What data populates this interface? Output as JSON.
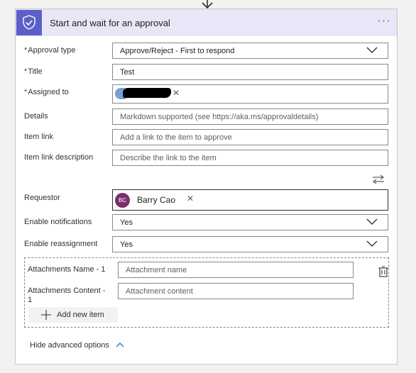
{
  "header": {
    "title": "Start and wait for an approval",
    "more_label": "···"
  },
  "fields": {
    "approval_type": {
      "label": "Approval type",
      "required": "*",
      "value": "Approve/Reject - First to respond"
    },
    "title": {
      "label": "Title",
      "required": "*",
      "value": "Test"
    },
    "assigned_to": {
      "label": "Assigned to",
      "required": "*"
    },
    "details": {
      "label": "Details",
      "placeholder": "Markdown supported (see https://aka.ms/approvaldetails)"
    },
    "item_link": {
      "label": "Item link",
      "placeholder": "Add a link to the item to approve"
    },
    "item_link_description": {
      "label": "Item link description",
      "placeholder": "Describe the link to the item"
    },
    "requestor": {
      "label": "Requestor",
      "avatar_initials": "BC",
      "value": "Barry Cao"
    },
    "enable_notifications": {
      "label": "Enable notifications",
      "value": "Yes"
    },
    "enable_reassignment": {
      "label": "Enable reassignment",
      "value": "Yes"
    }
  },
  "attachments": {
    "name_label": "Attachments Name - 1",
    "name_placeholder": "Attachment name",
    "content_label_line1": "Attachments Content -",
    "content_label_line2": "1",
    "content_placeholder": "Attachment content",
    "add_label": "Add new item"
  },
  "footer": {
    "hide_advanced": "Hide advanced options"
  },
  "colors": {
    "header_bg": "#e8e6f7",
    "icon_bg": "#5c5fc6",
    "accent": "#0078d4",
    "required": "#a4262c",
    "avatar": "#7a2f6d"
  }
}
